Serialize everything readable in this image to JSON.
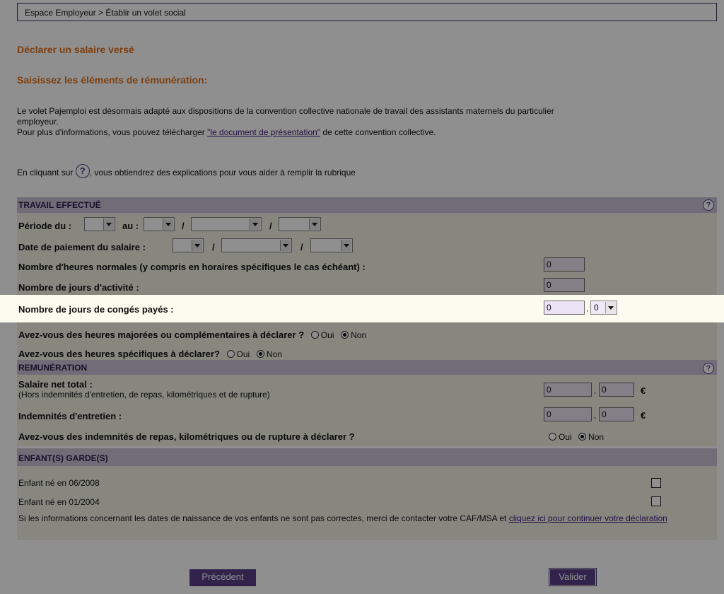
{
  "breadcrumb": "Espace Employeur > Établir un volet social",
  "heading": "Déclarer un salaire versé",
  "subheading": "Saisissez les éléments de rémunération:",
  "intro": {
    "line1": "Le volet Pajemploi est désormais adapté aux dispositions de la convention collective nationale de travail des assistants maternels du particulier",
    "line2": "employeur.",
    "line3_before": "Pour plus d'informations, vous pouvez télécharger ",
    "line3_link": "\"le document de présentation\"",
    "line3_after": " de cette convention collective."
  },
  "help_hint": {
    "before": "En cliquant sur ",
    "after": ", vous obtiendrez des explications pour vous aider à remplir la rubrique",
    "icon": "help-circle-icon"
  },
  "travail": {
    "title": "TRAVAIL EFFECTUÉ",
    "periode_du": "Période du :",
    "au": "au :",
    "slash": "/",
    "date_paiement": "Date de paiement du salaire :",
    "heures_normales": "Nombre d'heures normales (y compris en horaires spécifiques le cas échéant) :",
    "heures_normales_value": "0",
    "jours_activite": "Nombre de jours d'activité :",
    "jours_activite_value": "0",
    "conges": "Nombre de jours de congés payés :",
    "conges_value": "0",
    "conges_comma": ",",
    "conges_decimal": "0",
    "majorees_q": "Avez-vous des heures majorées ou complémentaires à déclarer ?",
    "specifiques_q": "Avez-vous des heures spécifiques à déclarer?",
    "oui": "Oui",
    "non": "Non"
  },
  "remuneration": {
    "title": "REMUNÉRATION",
    "salaire_label": "Salaire net total :",
    "salaire_sub": "(Hors indemnités d'entretien, de repas, kilométriques et de rupture)",
    "salaire_int": "0",
    "salaire_dec": "0",
    "indemnites_label": "Indemnités d'entretien :",
    "indemnites_int": "0",
    "indemnites_dec": "0",
    "comma": ",",
    "euro": "€",
    "repas_q": "Avez-vous des indemnités de repas, kilométriques ou de rupture à déclarer ?",
    "oui": "Oui",
    "non": "Non"
  },
  "enfants": {
    "title": "ENFANT(S) GARDE(S)",
    "items": [
      {
        "label": "Enfant né en 06/2008"
      },
      {
        "label": "Enfant né en 01/2004"
      }
    ],
    "note_before": "Si les informations concernant les dates de naissance de vos enfants ne sont pas correctes, merci de contacter votre CAF/MSA et ",
    "note_link": "cliquez ici pour continuer votre déclaration"
  },
  "buttons": {
    "precedent": "Précédent",
    "valider": "Valider"
  }
}
